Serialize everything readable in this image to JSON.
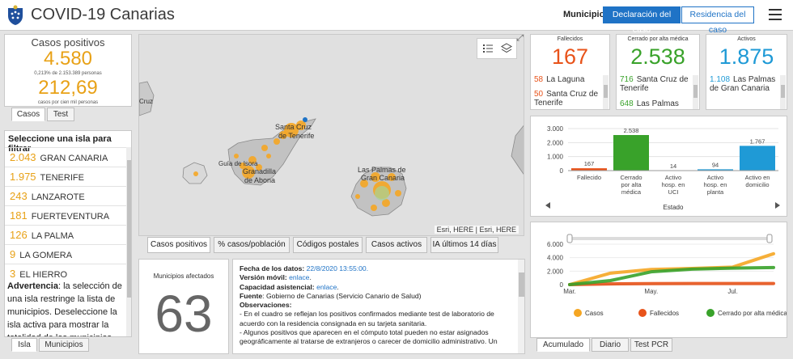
{
  "header": {
    "title": "COVID-19 Canarias",
    "municipio_label": "Municipio",
    "btn_declaracion": "Declaración del caso",
    "btn_residencia": "Residencia del caso"
  },
  "casos": {
    "title": "Casos positivos",
    "value": "4.580",
    "pct": "0,213% de 2.153.389 personas",
    "rate": "212,69",
    "rate_label": "casos por cien mil personas",
    "tabs": [
      "Casos",
      "Test"
    ]
  },
  "islands": {
    "title": "Seleccione una isla para filtrar",
    "items": [
      {
        "value": "2.043",
        "name": "GRAN CANARIA"
      },
      {
        "value": "1.975",
        "name": "TENERIFE"
      },
      {
        "value": "243",
        "name": "LANZAROTE"
      },
      {
        "value": "181",
        "name": "FUERTEVENTURA"
      },
      {
        "value": "126",
        "name": "LA PALMA"
      },
      {
        "value": "9",
        "name": "LA GOMERA"
      },
      {
        "value": "3",
        "name": "EL HIERRO"
      }
    ],
    "warning_bold": "Advertencia",
    "warning_text": ": la selección de una isla restringe la lista de municipios. Deseleccione la isla activa para mostrar la totalidad de los municipios.",
    "tabs": [
      "Isla",
      "Municipios"
    ]
  },
  "map": {
    "places": [
      "Santa Cruz de Tenerife",
      "Guía de Isora",
      "Granadilla de Abona",
      "Las Palmas de Gran Canaria",
      "Cruz"
    ],
    "attribution": "Esri, HERE | Esri, HERE",
    "tabs": [
      "Casos positivos",
      "% casos/población",
      "Códigos postales",
      "Casos activos",
      "IA últimos 14 días"
    ],
    "zoom_icon": "expand-icon",
    "tool_icons": [
      "list-icon",
      "layers-icon"
    ]
  },
  "municipios": {
    "title": "Municipios afectados",
    "value": "63"
  },
  "notes": {
    "fecha_label": "Fecha de los datos:",
    "fecha_value": "22/8/2020 13:55:00.",
    "version_label": "Versión móvil:",
    "version_link": "enlace",
    "capacidad_label": "Capacidad asistencial:",
    "capacidad_link": "enlace",
    "fuente_label": "Fuente",
    "fuente_text": ": Gobierno de Canarias (Servicio Canario de Salud)",
    "obs_label": "Observaciones:",
    "obs_1": "- En el cuadro se reflejan los positivos confirmados mediante test de laboratorio de acuerdo con la residencia consignada en su tarjeta sanitaria.",
    "obs_2": "- Algunos positivos que aparecen en el cómputo total pueden no estar asignados geográficamente al tratarse de extranjeros o carecer de domicilio administrativo. Un"
  },
  "cards": {
    "fallecidos": {
      "title": "Fallecidos",
      "value": "167",
      "color": "#e8531a",
      "items": [
        {
          "value": "58",
          "name": "La Laguna"
        },
        {
          "value": "50",
          "name": "Santa Cruz de Tenerife"
        }
      ]
    },
    "cerrado": {
      "title": "Cerrado por alta médica",
      "value": "2.538",
      "color": "#39a22a",
      "items": [
        {
          "value": "716",
          "name": "Santa Cruz de Tenerife"
        },
        {
          "value": "648",
          "name": "Las Palmas"
        }
      ]
    },
    "activos": {
      "title": "Activos",
      "value": "1.875",
      "color": "#1f9ad6",
      "items": [
        {
          "value": "1.108",
          "name": "Las Palmas de Gran Canaria"
        }
      ]
    }
  },
  "chart_data": [
    {
      "type": "bar",
      "categories": [
        "Fallecido",
        "Cerrado por alta médica",
        "Activo hosp. en UCI",
        "Activo hosp. en planta",
        "Activo en domicilio"
      ],
      "category_lines": [
        [
          "Fallecido"
        ],
        [
          "Cerrado",
          "por alta",
          "médica"
        ],
        [
          "Activo",
          "hosp. en",
          "UCI"
        ],
        [
          "Activo",
          "hosp. en",
          "planta"
        ],
        [
          "Activo en",
          "domicilio"
        ]
      ],
      "values": [
        167,
        2538,
        14,
        94,
        1767
      ],
      "data_labels": [
        "167",
        "2.538",
        "14",
        "94",
        "1.767"
      ],
      "colors": [
        "#e8531a",
        "#39a22a",
        "#1f9ad6",
        "#1f9ad6",
        "#1f9ad6"
      ],
      "xlabel": "Estado",
      "ylim": [
        0,
        3000
      ],
      "yticks": [
        0,
        1000,
        2000,
        3000
      ],
      "ytick_labels": [
        "0",
        "1.000",
        "2.000",
        "3.000"
      ],
      "grid": true
    },
    {
      "type": "line",
      "x": [
        "Mar.",
        "Abr.",
        "May.",
        "Jun.",
        "Jul.",
        "Ago."
      ],
      "xtick_labels": [
        "Mar.",
        "May.",
        "Jul."
      ],
      "series": [
        {
          "name": "Casos",
          "color": "#f5a623",
          "values": [
            0,
            1700,
            2250,
            2400,
            2600,
            4580
          ]
        },
        {
          "name": "Fallecidos",
          "color": "#e8531a",
          "values": [
            0,
            110,
            150,
            160,
            162,
            167
          ]
        },
        {
          "name": "Cerrado por alta médica",
          "color": "#39a22a",
          "values": [
            0,
            600,
            1900,
            2300,
            2450,
            2538
          ]
        }
      ],
      "ylim": [
        0,
        6000
      ],
      "yticks": [
        0,
        2000,
        4000,
        6000
      ],
      "ytick_labels": [
        "0",
        "2.000",
        "4.000",
        "6.000"
      ],
      "legend_position": "bottom",
      "tabs": [
        "Acumulado",
        "Diario",
        "Test PCR"
      ]
    }
  ]
}
